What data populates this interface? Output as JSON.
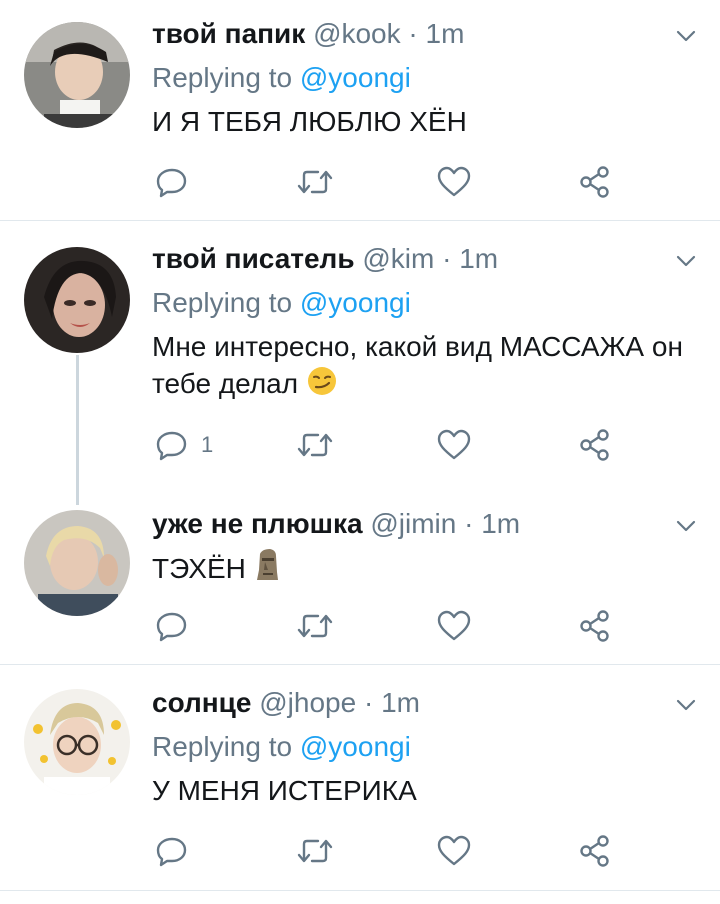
{
  "icons": [
    "chevron-down-icon",
    "reply-icon",
    "retweet-icon",
    "like-icon",
    "share-icon"
  ],
  "colors": {
    "name": "#14171a",
    "meta": "#657786",
    "link": "#1da1f2",
    "divider": "#e1e8ed",
    "thread": "#ccd6dd"
  },
  "tweets": [
    {
      "name": "твой папик",
      "handle": "@kook",
      "dot": "·",
      "time": "1m",
      "replying_label": "Replying to",
      "replying_to": "@yoongi",
      "text": "И Я ТЕБЯ ЛЮБЛЮ ХЁН",
      "reply_count": ""
    },
    {
      "name": "твой писатель",
      "handle": "@kim",
      "dot": "·",
      "time": "1m",
      "replying_label": "Replying to",
      "replying_to": "@yoongi",
      "text": "Мне интересно, какой вид МАССАЖА он тебе делал",
      "emoji": "smirking-face",
      "reply_count": "1"
    },
    {
      "name": "уже не плюшка",
      "handle": "@jimin",
      "dot": "·",
      "time": "1m",
      "text": "ТЭХЁН",
      "emoji": "moai",
      "reply_count": ""
    },
    {
      "name": "солнце",
      "handle": "@jhope",
      "dot": "·",
      "time": "1m",
      "replying_label": "Replying to",
      "replying_to": "@yoongi",
      "text": "У МЕНЯ ИСТЕРИКА",
      "reply_count": ""
    }
  ]
}
